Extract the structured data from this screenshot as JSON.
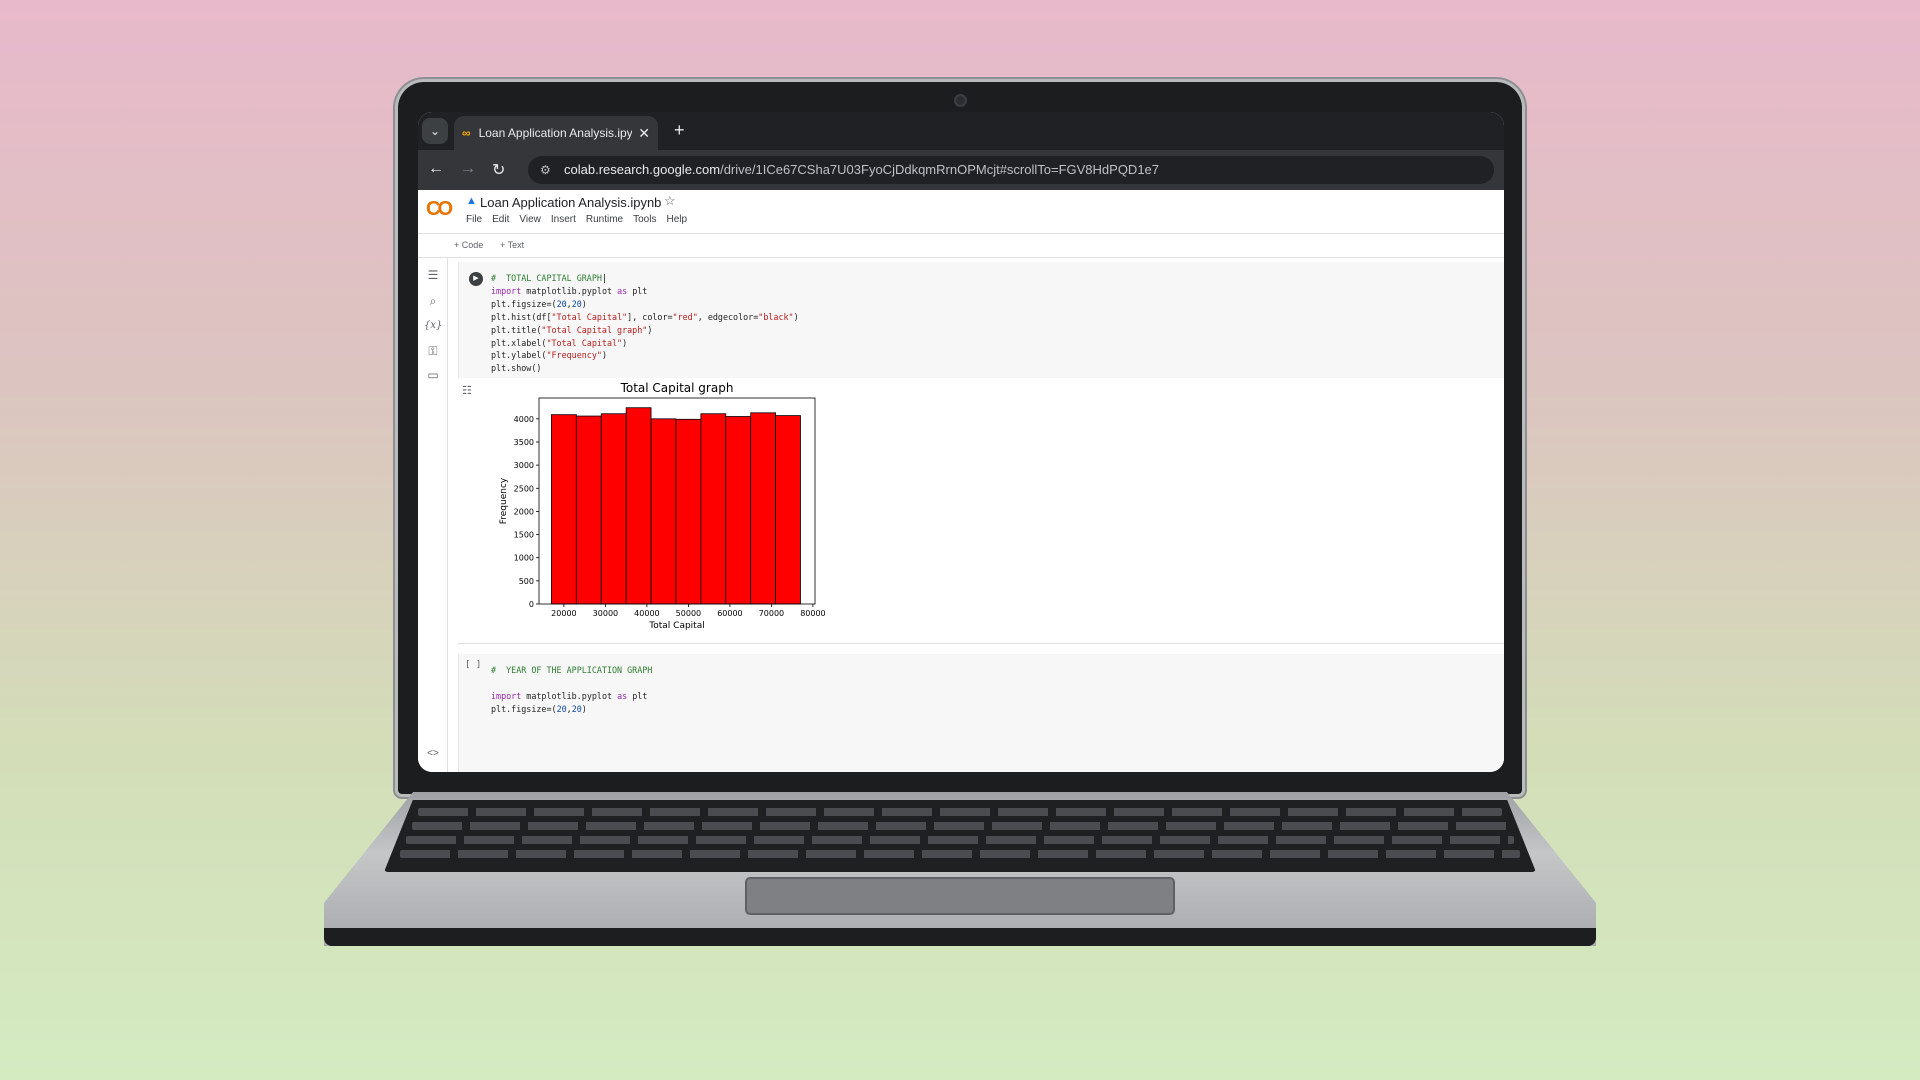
{
  "browser": {
    "tab_menu_icon": "chevron-down-icon",
    "tab_title": "Loan Application Analysis.ipynb",
    "tab_close": "✕",
    "new_tab": "+",
    "url_host": "colab.research.google.com",
    "url_path": "/drive/1ICe67CSha7U03FyoCjDdkqmRrnOPMcjt#scrollTo=FGV8HdPQD1e7"
  },
  "colab": {
    "logo_left": "C",
    "logo_right": "O",
    "notebook_title": "Loan Application Analysis.ipynb",
    "menu": [
      "File",
      "Edit",
      "View",
      "Insert",
      "Runtime",
      "Tools",
      "Help"
    ],
    "add_code": "+ Code",
    "add_text": "+ Text"
  },
  "sidebar": {
    "icons": [
      "table-of-contents-icon",
      "search-icon",
      "variables-icon",
      "secrets-key-icon",
      "folder-icon"
    ],
    "variables_label": "{x}",
    "bottom_icon": "code-brackets-icon",
    "bottom_label": "<>"
  },
  "cells": [
    {
      "type": "code",
      "lines": [
        "#  TOTAL CAPITAL GRAPH",
        "import matplotlib.pyplot as plt",
        "plt.figsize=(20,20)",
        "plt.hist(df[\"Total Capital\"], color=\"red\", edgecolor=\"black\")",
        "plt.title(\"Total Capital graph\")",
        "plt.xlabel(\"Total Capital\")",
        "plt.ylabel(\"Frequency\")",
        "plt.show()"
      ]
    },
    {
      "type": "code",
      "exec_count": "[ ]",
      "lines": [
        "#  YEAR OF THE APPLICATION GRAPH",
        "",
        "import matplotlib.pyplot as plt",
        "plt.figsize=(20,20)"
      ]
    }
  ],
  "chart_data": {
    "type": "bar",
    "title": "Total Capital graph",
    "xlabel": "Total Capital",
    "ylabel": "Frequency",
    "bin_edges": [
      17000,
      23000,
      29000,
      35000,
      41000,
      47000,
      53000,
      59000,
      65000,
      71000,
      77000
    ],
    "values": [
      4090,
      4060,
      4110,
      4240,
      4000,
      3990,
      4110,
      4050,
      4130,
      4070
    ],
    "xticks": [
      20000,
      30000,
      40000,
      50000,
      60000,
      70000,
      80000
    ],
    "yticks": [
      0,
      500,
      1000,
      1500,
      2000,
      2500,
      3000,
      3500,
      4000
    ],
    "xlim": [
      14000,
      80500
    ],
    "ylim": [
      0,
      4450
    ],
    "bar_color": "#ff0000",
    "edge_color": "#000000"
  }
}
